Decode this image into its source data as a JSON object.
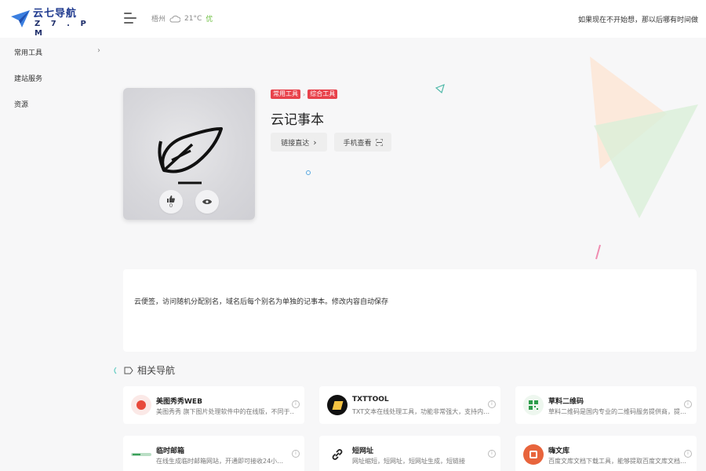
{
  "header": {
    "logo_text": "云七导航",
    "logo_sub": "Z 7 . P M",
    "city": "梧州",
    "temperature": "21°C",
    "aqi": "优",
    "motto": "如果现在不开始想，那以后哪有时间做"
  },
  "sidebar": {
    "items": [
      {
        "label": "常用工具",
        "has_children": true
      },
      {
        "label": "建站服务"
      },
      {
        "label": "资源"
      }
    ]
  },
  "site": {
    "tags": [
      "常用工具",
      "综合工具"
    ],
    "tag_separator": "›",
    "title": "云记事本",
    "like_count": "0",
    "link_button": "链接直达",
    "mobile_button": "手机查看",
    "description": "云便签，访问随机分配别名，域名后每个别名为单独的记事本。修改内容自动保存"
  },
  "related": {
    "title": "相关导航",
    "cards": [
      {
        "name": "美图秀秀WEB",
        "desc": "美图秀秀 旗下图片处理软件中的在线版，不同于…",
        "icon": "meitu-icon",
        "color": "#e84a3c"
      },
      {
        "name": "TXTTOOL",
        "desc": "TXT文本在线处理工具，功能非常强大，支持内…",
        "icon": "txttool-icon",
        "color": "#111111"
      },
      {
        "name": "草料二维码",
        "desc": "草料二维码是国内专业的二维码服务提供商，提…",
        "icon": "qrcode-icon",
        "color": "#2e9d4b"
      },
      {
        "name": "临时邮箱",
        "desc": "在线生成临时邮箱网站，开通即可接收24小…",
        "icon": "mail-icon",
        "color": "#3aa05a"
      },
      {
        "name": "短网址",
        "desc": "网址缩短，短网址，短网址生成，短链接",
        "icon": "link-icon",
        "color": "#222222"
      },
      {
        "name": "嗨文库",
        "desc": "百度文库文档下载工具，能够提取百度文库文档…",
        "icon": "hiwenku-icon",
        "color": "#e8643c"
      }
    ]
  }
}
